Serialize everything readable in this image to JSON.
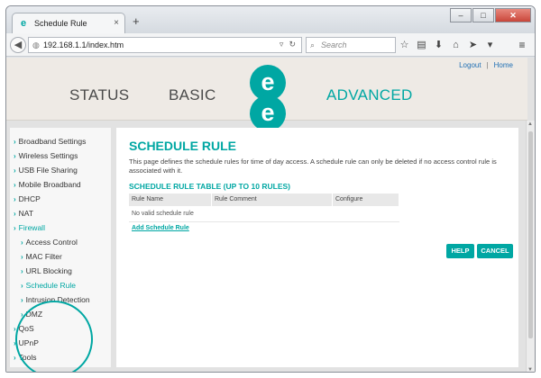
{
  "browser": {
    "tab_title": "Schedule Rule",
    "tab_close": "×",
    "new_tab": "+",
    "url": "192.168.1.1/index.htm",
    "search_placeholder": "Search",
    "window_min": "–",
    "window_max": "□",
    "window_close": "✕"
  },
  "header": {
    "logout": "Logout",
    "link_sep": "|",
    "home": "Home",
    "nav_status": "STATUS",
    "nav_basic": "BASIC",
    "nav_advanced": "ADVANCED",
    "logo_glyph": "e"
  },
  "sidebar": {
    "items": [
      {
        "label": "Broadband Settings",
        "level": 0
      },
      {
        "label": "Wireless Settings",
        "level": 0
      },
      {
        "label": "USB File Sharing",
        "level": 0
      },
      {
        "label": "Mobile Broadband",
        "level": 0
      },
      {
        "label": "DHCP",
        "level": 0
      },
      {
        "label": "NAT",
        "level": 0
      },
      {
        "label": "Firewall",
        "level": 0
      },
      {
        "label": "Access Control",
        "level": 1
      },
      {
        "label": "MAC Filter",
        "level": 1
      },
      {
        "label": "URL Blocking",
        "level": 1
      },
      {
        "label": "Schedule Rule",
        "level": 1,
        "active": true
      },
      {
        "label": "Intrusion Detection",
        "level": 1
      },
      {
        "label": "DMZ",
        "level": 1
      },
      {
        "label": "QoS",
        "level": 0
      },
      {
        "label": "UPnP",
        "level": 0
      },
      {
        "label": "Tools",
        "level": 0
      }
    ]
  },
  "main": {
    "title": "SCHEDULE RULE",
    "description": "This page defines the schedule rules for time of day access. A schedule rule can only be deleted if no access control rule is associated with it.",
    "table_title": "SCHEDULE RULE TABLE (UP TO 10 RULES)",
    "columns": [
      "Rule Name",
      "Rule Comment",
      "Configure"
    ],
    "empty_row": "No valid schedule rule",
    "add_link": "Add Schedule Rule",
    "help_button": "HELP",
    "cancel_button": "CANCEL"
  },
  "colors": {
    "accent": "#00a7a3",
    "nav_text": "#4a4a4a",
    "header_bg": "#eeeae5"
  }
}
